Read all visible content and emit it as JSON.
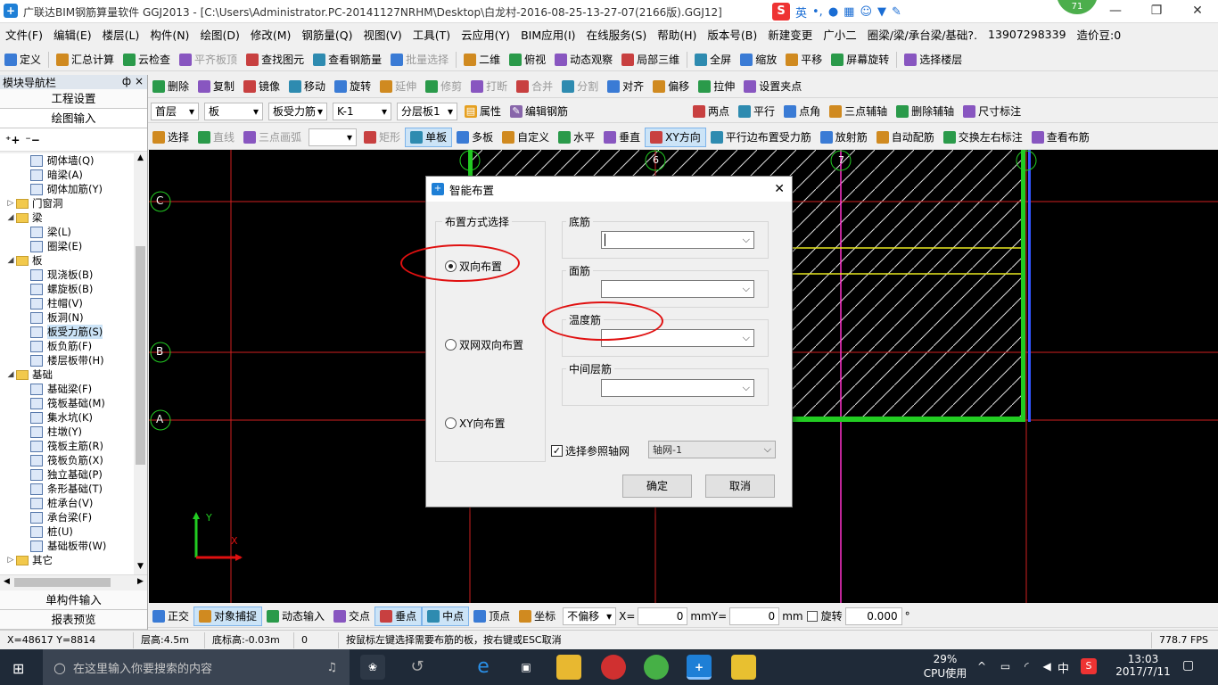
{
  "app": {
    "title": "广联达BIM钢筋算量软件 GGJ2013 - [C:\\Users\\Administrator.PC-20141127NRHM\\Desktop\\白龙村-2016-08-25-13-27-07(2166版).GGJ12]",
    "badge": "71",
    "ime": "英"
  },
  "menu": [
    "文件(F)",
    "编辑(E)",
    "楼层(L)",
    "构件(N)",
    "绘图(D)",
    "修改(M)",
    "钢筋量(Q)",
    "视图(V)",
    "工具(T)",
    "云应用(Y)",
    "BIM应用(I)",
    "在线服务(S)",
    "帮助(H)",
    "版本号(B)",
    "新建变更",
    "广小二",
    "圈梁/梁/承台梁/基础?.",
    "13907298339",
    "造价豆:0"
  ],
  "toolbar1": [
    "定义",
    "汇总计算",
    "云检查",
    "平齐板顶",
    "查找图元",
    "查看钢筋量",
    "批量选择",
    "二维",
    "俯视",
    "动态观察",
    "局部三维",
    "全屏",
    "缩放",
    "平移",
    "屏幕旋转",
    "选择楼层"
  ],
  "toolbar2": [
    "删除",
    "复制",
    "镜像",
    "移动",
    "旋转",
    "延伸",
    "修剪",
    "打断",
    "合并",
    "分割",
    "对齐",
    "偏移",
    "拉伸",
    "设置夹点"
  ],
  "toolbar3": {
    "floor": "首层",
    "type": "板",
    "sub": "板受力筋",
    "item": "K-1",
    "layer": "分层板1",
    "attr": "属性",
    "edit": "编辑钢筋",
    "right": [
      "两点",
      "平行",
      "点角",
      "三点辅轴",
      "删除辅轴",
      "尺寸标注"
    ]
  },
  "toolbar4": [
    "选择",
    "直线",
    "三点画弧",
    "矩形",
    "单板",
    "多板",
    "自定义",
    "水平",
    "垂直",
    "XY方向",
    "平行边布置受力筋",
    "放射筋",
    "自动配筋",
    "交换左右标注",
    "查看布筋"
  ],
  "nav": {
    "title": "模块导航栏",
    "pin": "ф",
    "close": "×",
    "btn_settings": "工程设置",
    "btn_draw": "绘图输入",
    "btn_single": "单构件输入",
    "btn_report": "报表预览"
  },
  "tree": [
    {
      "label": "砌体墙(Q)",
      "level": 2
    },
    {
      "label": "暗梁(A)",
      "level": 2
    },
    {
      "label": "砌体加筋(Y)",
      "level": 2
    },
    {
      "label": "门窗洞",
      "level": 0,
      "folder": true,
      "exp": "+"
    },
    {
      "label": "梁",
      "level": 0,
      "folder": true,
      "exp": "-"
    },
    {
      "label": "梁(L)",
      "level": 2
    },
    {
      "label": "圈梁(E)",
      "level": 2
    },
    {
      "label": "板",
      "level": 0,
      "folder": true,
      "exp": "-"
    },
    {
      "label": "现浇板(B)",
      "level": 2
    },
    {
      "label": "螺旋板(B)",
      "level": 2
    },
    {
      "label": "柱帽(V)",
      "level": 2
    },
    {
      "label": "板洞(N)",
      "level": 2
    },
    {
      "label": "板受力筋(S)",
      "level": 2,
      "hl": true
    },
    {
      "label": "板负筋(F)",
      "level": 2
    },
    {
      "label": "楼层板带(H)",
      "level": 2
    },
    {
      "label": "基础",
      "level": 0,
      "folder": true,
      "exp": "-"
    },
    {
      "label": "基础梁(F)",
      "level": 2
    },
    {
      "label": "筏板基础(M)",
      "level": 2
    },
    {
      "label": "集水坑(K)",
      "level": 2
    },
    {
      "label": "柱墩(Y)",
      "level": 2
    },
    {
      "label": "筏板主筋(R)",
      "level": 2
    },
    {
      "label": "筏板负筋(X)",
      "level": 2
    },
    {
      "label": "独立基础(P)",
      "level": 2
    },
    {
      "label": "条形基础(T)",
      "level": 2
    },
    {
      "label": "桩承台(V)",
      "level": 2
    },
    {
      "label": "承台梁(F)",
      "level": 2
    },
    {
      "label": "桩(U)",
      "level": 2
    },
    {
      "label": "基础板带(W)",
      "level": 2
    },
    {
      "label": "其它",
      "level": 0,
      "folder": true,
      "exp": "+"
    }
  ],
  "axes": {
    "C": "C",
    "B": "B",
    "A": "A",
    "n6": "6",
    "n7": "7",
    "y": "Y",
    "x": "X"
  },
  "dialog": {
    "title": "智能布置",
    "group_method": "布置方式选择",
    "opt1": "双向布置",
    "opt2": "双网双向布置",
    "opt3": "XY向布置",
    "bottom": "底筋",
    "top": "面筋",
    "temp": "温度筋",
    "middle": "中间层筋",
    "ref_axis": "选择参照轴网",
    "axis_val": "轴网-1",
    "ok": "确定",
    "cancel": "取消"
  },
  "snapbar": {
    "items": [
      "正交",
      "对象捕捉",
      "动态输入",
      "交点",
      "垂点",
      "中点",
      "顶点",
      "坐标"
    ],
    "offset": "不偏移",
    "x_label": "X=",
    "x_val": "0",
    "mm1": "mm",
    "y_label": "Y=",
    "y_val": "0",
    "mm2": "mm",
    "rot": "旋转",
    "rot_val": "0.000",
    "deg": "°"
  },
  "status": {
    "coord": "X=48617 Y=8814",
    "floor_h": "层高:4.5m",
    "base_h": "底标高:-0.03m",
    "zero": "0",
    "hint": "按鼠标左键选择需要布筋的板，按右键或ESC取消",
    "fps": "778.7 FPS"
  },
  "taskbar": {
    "search": "在这里输入你要搜索的内容",
    "cpu_pct": "29%",
    "cpu_label": "CPU使用",
    "lang": "中",
    "time": "13:03",
    "date": "2017/7/11"
  },
  "colors": {
    "accent": "#1e7fd6",
    "canvas": "#000000",
    "ellipse": "#e01010",
    "green": "#22cc22"
  }
}
